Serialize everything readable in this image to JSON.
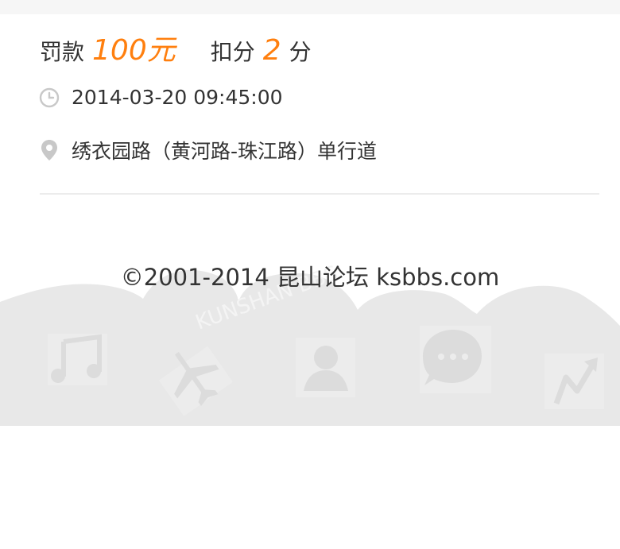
{
  "fine": {
    "label": "罚款",
    "amount": "100元"
  },
  "points": {
    "label": "扣分",
    "value": "2",
    "unit": "分"
  },
  "violation": {
    "time": "2014-03-20 09:45:00",
    "location": "绣衣园路（黄河路-珠江路）单行道"
  },
  "footer": {
    "copyright": "©2001-2014 昆山论坛 ksbbs.com",
    "watermark": "KUNSHAN BBS",
    "icons": [
      "music-icon",
      "airplane-icon",
      "person-icon",
      "chat-icon",
      "trend-icon"
    ]
  },
  "colors": {
    "accent": "#ff7f0e",
    "text": "#333333",
    "footer_bg": "#e8e8e8"
  }
}
